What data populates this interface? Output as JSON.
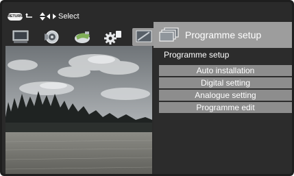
{
  "hint": {
    "return_label": "RETURN",
    "select_label": "Select"
  },
  "tabs": [
    {
      "icon": "picture-icon",
      "active": false
    },
    {
      "icon": "audio-icon",
      "active": false
    },
    {
      "icon": "power-icon",
      "active": false
    },
    {
      "icon": "setup-icon",
      "active": false
    },
    {
      "icon": "option-icon",
      "active": true
    }
  ],
  "panel": {
    "header_title": "Programme setup",
    "subtitle": "Programme setup",
    "items": [
      {
        "label": "Auto installation"
      },
      {
        "label": "Digital setting"
      },
      {
        "label": "Analogue setting"
      },
      {
        "label": "Programme edit"
      }
    ]
  },
  "colors": {
    "menu_item_bg": "#8d8d8d",
    "header_bg": "#9d9d9d",
    "screen_bg": "#2a2a2a"
  }
}
